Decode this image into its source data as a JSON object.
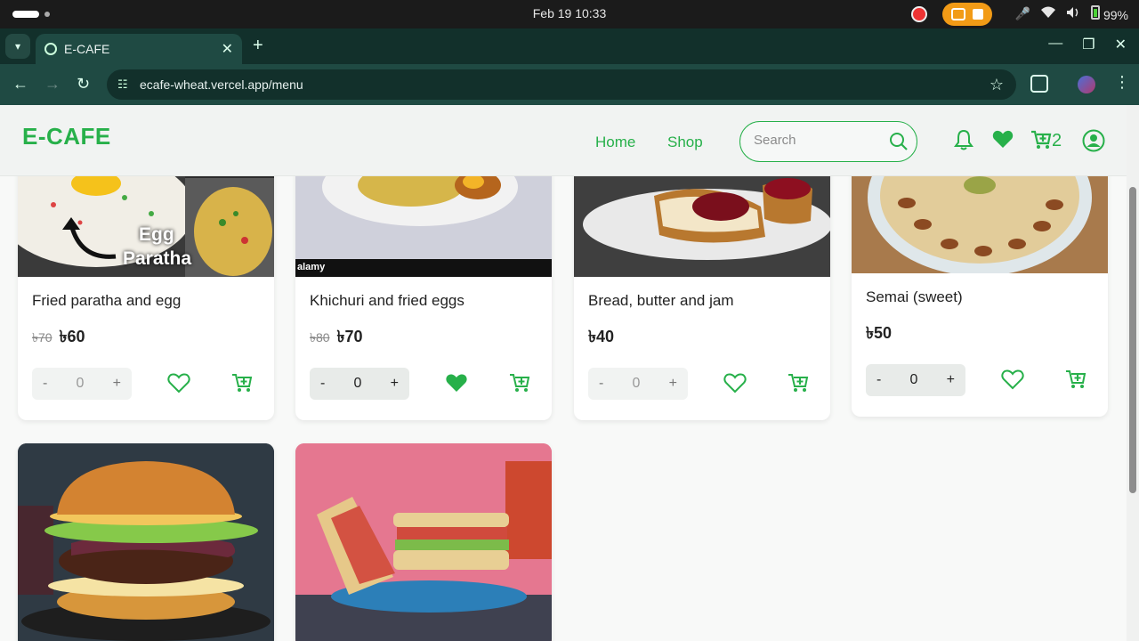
{
  "os": {
    "clock": "Feb 19  10:33",
    "battery": "99%"
  },
  "browser": {
    "tab_title": "E-CAFE",
    "url": "ecafe-wheat.vercel.app/menu"
  },
  "site": {
    "logo": "E-CAFE",
    "nav": [
      "Home",
      "Shop"
    ],
    "search_placeholder": "Search",
    "cart_count": "2",
    "brand_color": "#27b04a"
  },
  "products": [
    {
      "name": "Fried paratha and egg",
      "old_price": "৳70",
      "price": "৳60",
      "qty": "0",
      "favorited": false,
      "image_text": [
        "Egg",
        "Paratha"
      ]
    },
    {
      "name": "Khichuri and fried eggs",
      "old_price": "৳80",
      "price": "৳70",
      "qty": "0",
      "favorited": true,
      "image_text": [
        "alamy"
      ]
    },
    {
      "name": "Bread, butter and jam",
      "old_price": "",
      "price": "৳40",
      "qty": "0",
      "favorited": false
    },
    {
      "name": "Semai (sweet)",
      "old_price": "",
      "price": "৳50",
      "qty": "0",
      "favorited": false
    },
    {
      "name": "Burger",
      "image_only": true
    },
    {
      "name": "Sandwich",
      "image_only": true
    }
  ],
  "qty_controls": {
    "minus": "-",
    "plus": "+"
  }
}
